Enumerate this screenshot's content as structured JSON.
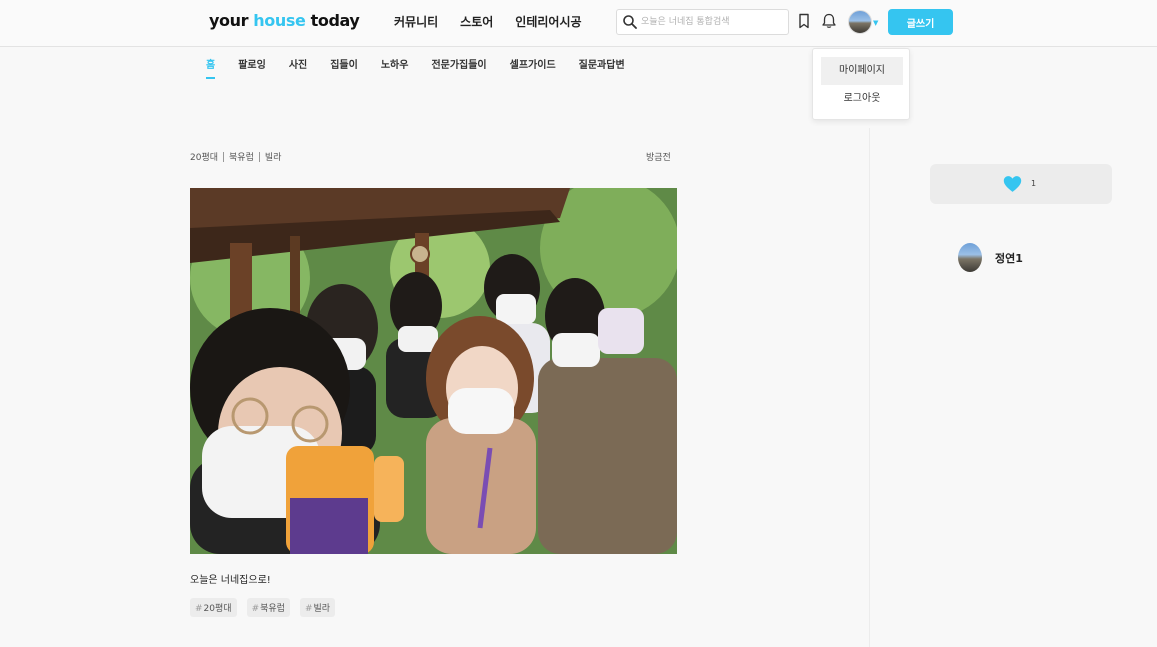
{
  "header": {
    "logo_part1": "your",
    "logo_part2": "house",
    "logo_part3": "today",
    "nav": [
      "커뮤니티",
      "스토어",
      "인테리어시공"
    ],
    "search_placeholder": "오늘은 너네집 통합검색",
    "write_button": "글쓰기",
    "brand_color": "#35c5f0"
  },
  "dropdown": {
    "items": [
      "마이페이지",
      "로그아웃"
    ]
  },
  "subnav": {
    "items": [
      "홈",
      "팔로잉",
      "사진",
      "집들이",
      "노하우",
      "전문가집들이",
      "셀프가이드",
      "질문과답변"
    ],
    "active_index": 0
  },
  "post": {
    "meta": [
      "20평대",
      "북유럽",
      "빌라"
    ],
    "date": "방금전",
    "caption": "오늘은 너네집으로!",
    "tags": [
      "20평대",
      "북유럽",
      "빌라"
    ],
    "image_description": "group selfie of people wearing masks under a wooden pavilion"
  },
  "sidebar": {
    "like_count": "1",
    "author_name": "정연1"
  }
}
